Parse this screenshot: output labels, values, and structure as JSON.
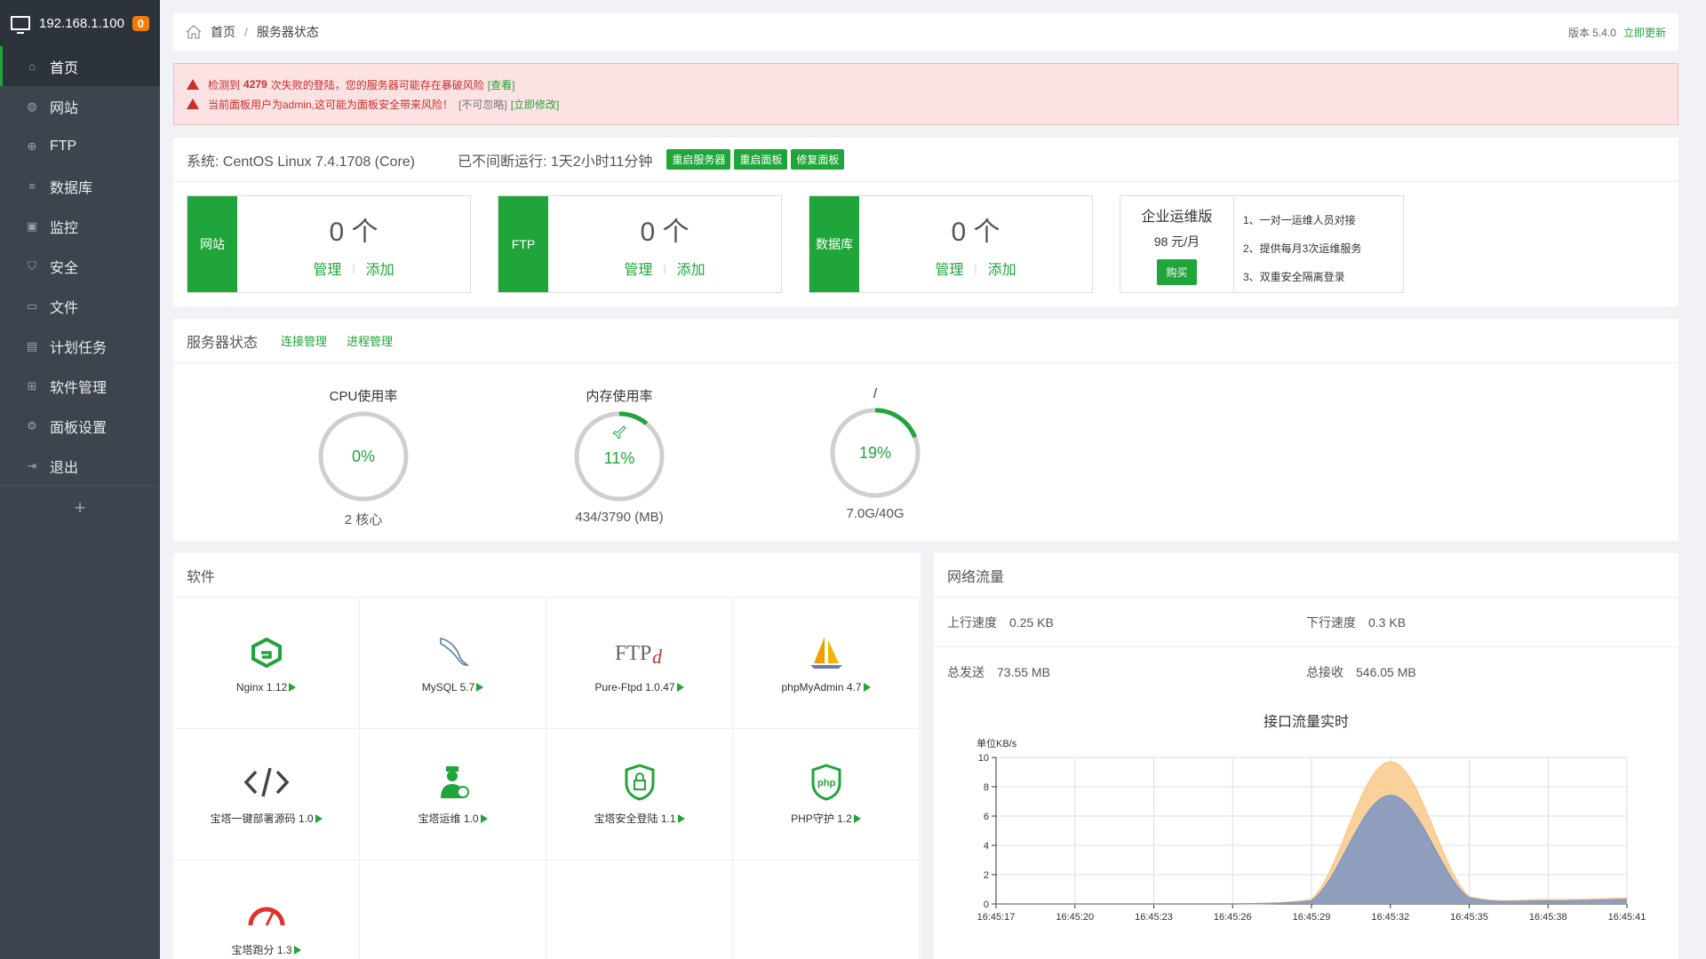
{
  "sidebar": {
    "ip": "192.168.1.100",
    "badge": "0",
    "items": [
      {
        "label": "首页",
        "icon": "home-icon"
      },
      {
        "label": "网站",
        "icon": "globe-icon"
      },
      {
        "label": "FTP",
        "icon": "ftp-icon"
      },
      {
        "label": "数据库",
        "icon": "database-icon"
      },
      {
        "label": "监控",
        "icon": "monitor-icon"
      },
      {
        "label": "安全",
        "icon": "shield-icon"
      },
      {
        "label": "文件",
        "icon": "folder-icon"
      },
      {
        "label": "计划任务",
        "icon": "calendar-icon"
      },
      {
        "label": "软件管理",
        "icon": "grid-icon"
      },
      {
        "label": "面板设置",
        "icon": "gear-icon"
      },
      {
        "label": "退出",
        "icon": "logout-icon"
      }
    ],
    "plus": "+"
  },
  "breadcrumb": {
    "home": "首页",
    "sep": "/",
    "current": "服务器状态",
    "version": "版本 5.4.0",
    "update": "立即更新"
  },
  "alerts": {
    "a1_pre": "检测到",
    "a1_count": "4279",
    "a1_post": "次失败的登陆，您的服务器可能存在暴破风险",
    "a1_link": "[查看]",
    "a2_text": "当前面板用户为admin,这可能为面板安全带来风险！",
    "a2_ignore": "[不可忽略]",
    "a2_link": "[立即修改]"
  },
  "system": {
    "os": "系统: CentOS Linux 7.4.1708 (Core)",
    "uptime": "已不间断运行: 1天2小时11分钟",
    "btn_restart_server": "重启服务器",
    "btn_restart_panel": "重启面板",
    "btn_repair_panel": "修复面板"
  },
  "stats": [
    {
      "tag": "网站",
      "count": "0 个",
      "manage": "管理",
      "sep": "|",
      "add": "添加"
    },
    {
      "tag": "FTP",
      "count": "0 个",
      "manage": "管理",
      "sep": "|",
      "add": "添加"
    },
    {
      "tag": "数据库",
      "count": "0 个",
      "manage": "管理",
      "sep": "|",
      "add": "添加"
    }
  ],
  "enterprise": {
    "title": "企业运维版",
    "price": "98 元/月",
    "buy": "购买",
    "features": [
      "1、一对一运维人员对接",
      "2、提供每月3次运维服务",
      "3、双重安全隔离登录"
    ]
  },
  "status": {
    "title": "服务器状态",
    "link1": "连接管理",
    "link2": "进程管理",
    "gauges": [
      {
        "title": "CPU使用率",
        "value": "0%",
        "percent": 0,
        "sub": "2 核心"
      },
      {
        "title": "内存使用率",
        "value": "11%",
        "percent": 11,
        "sub": "434/3790 (MB)"
      },
      {
        "title": "/",
        "value": "19%",
        "percent": 19,
        "sub": "7.0G/40G"
      }
    ]
  },
  "software": {
    "title": "软件",
    "items": [
      {
        "name": "Nginx 1.12",
        "icon": "nginx-icon"
      },
      {
        "name": "MySQL 5.7",
        "icon": "mysql-dolphin-icon"
      },
      {
        "name": "Pure-Ftpd 1.0.47",
        "icon": "ftp-logo-icon"
      },
      {
        "name": "phpMyAdmin 4.7",
        "icon": "phpmyadmin-sail-icon"
      },
      {
        "name": "宝塔一键部署源码 1.0",
        "icon": "code-icon"
      },
      {
        "name": "宝塔运维 1.0",
        "icon": "ops-user-icon"
      },
      {
        "name": "宝塔安全登陆 1.1",
        "icon": "lock-shield-icon"
      },
      {
        "name": "PHP守护 1.2",
        "icon": "php-shield-icon"
      },
      {
        "name": "宝塔跑分 1.3",
        "icon": "speedometer-icon"
      }
    ]
  },
  "network": {
    "title": "网络流量",
    "up_label": "上行速度",
    "up_value": "0.25 KB",
    "down_label": "下行速度",
    "down_value": "0.3 KB",
    "sent_label": "总发送",
    "sent_value": "73.55 MB",
    "recv_label": "总接收",
    "recv_value": "546.05 MB"
  },
  "chart_data": {
    "type": "area",
    "title": "接口流量实时",
    "ylabel": "单位KB/s",
    "ylim": [
      0,
      10
    ],
    "yticks": [
      0,
      2,
      4,
      6,
      8,
      10
    ],
    "x": [
      "16:45:17",
      "16:45:20",
      "16:45:23",
      "16:45:26",
      "16:45:29",
      "16:45:32",
      "16:45:35",
      "16:45:38",
      "16:45:41"
    ],
    "series": [
      {
        "color": "#f9c98a",
        "values": [
          0,
          0,
          0,
          0,
          0.3,
          9.7,
          0.5,
          0.3,
          0.4
        ]
      },
      {
        "color": "#7e97c4",
        "values": [
          0,
          0,
          0,
          0,
          0.2,
          7.4,
          0.4,
          0.2,
          0.3
        ]
      }
    ],
    "grid": true
  }
}
